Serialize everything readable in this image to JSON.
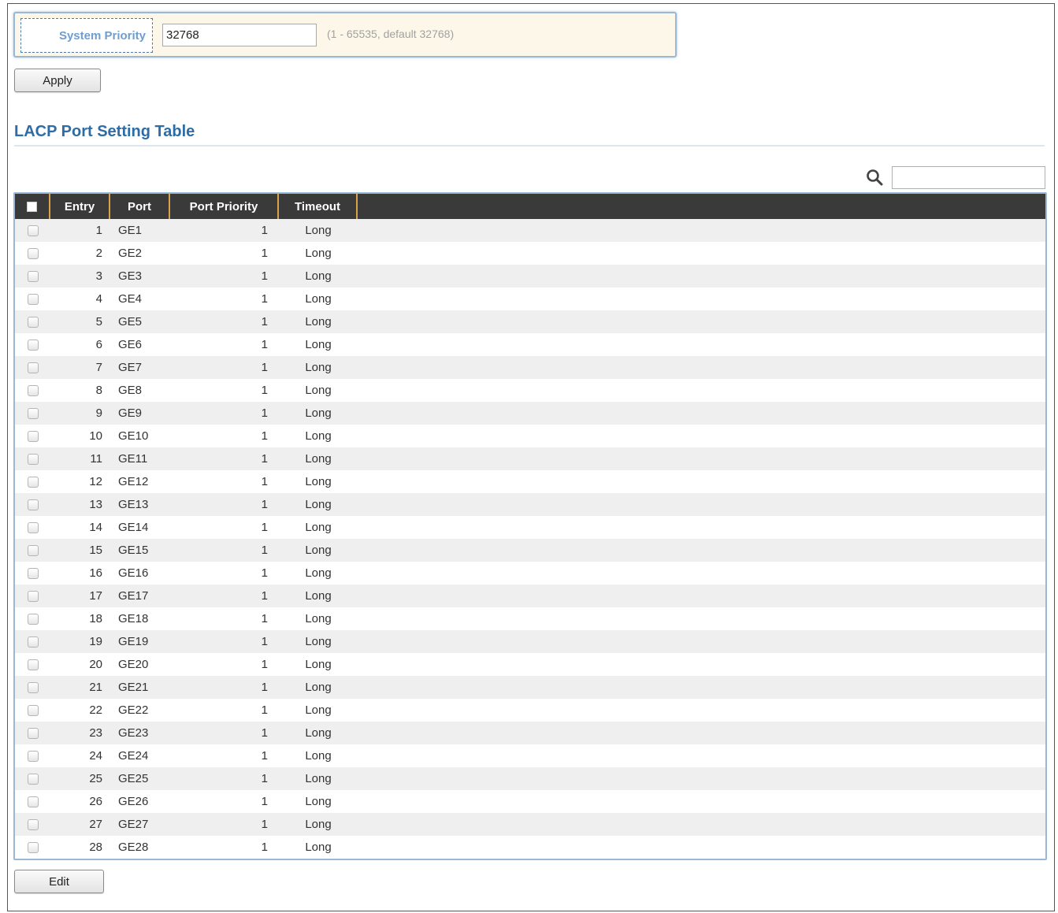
{
  "system": {
    "label": "System Priority",
    "value": "32768",
    "hint": "(1 - 65535, default 32768)",
    "apply_label": "Apply"
  },
  "section": {
    "title": "LACP Port Setting Table"
  },
  "search": {
    "icon": "search-icon",
    "value": ""
  },
  "table": {
    "headers": {
      "entry": "Entry",
      "port": "Port",
      "priority": "Port Priority",
      "timeout": "Timeout"
    },
    "rows": [
      {
        "entry": "1",
        "port": "GE1",
        "priority": "1",
        "timeout": "Long"
      },
      {
        "entry": "2",
        "port": "GE2",
        "priority": "1",
        "timeout": "Long"
      },
      {
        "entry": "3",
        "port": "GE3",
        "priority": "1",
        "timeout": "Long"
      },
      {
        "entry": "4",
        "port": "GE4",
        "priority": "1",
        "timeout": "Long"
      },
      {
        "entry": "5",
        "port": "GE5",
        "priority": "1",
        "timeout": "Long"
      },
      {
        "entry": "6",
        "port": "GE6",
        "priority": "1",
        "timeout": "Long"
      },
      {
        "entry": "7",
        "port": "GE7",
        "priority": "1",
        "timeout": "Long"
      },
      {
        "entry": "8",
        "port": "GE8",
        "priority": "1",
        "timeout": "Long"
      },
      {
        "entry": "9",
        "port": "GE9",
        "priority": "1",
        "timeout": "Long"
      },
      {
        "entry": "10",
        "port": "GE10",
        "priority": "1",
        "timeout": "Long"
      },
      {
        "entry": "11",
        "port": "GE11",
        "priority": "1",
        "timeout": "Long"
      },
      {
        "entry": "12",
        "port": "GE12",
        "priority": "1",
        "timeout": "Long"
      },
      {
        "entry": "13",
        "port": "GE13",
        "priority": "1",
        "timeout": "Long"
      },
      {
        "entry": "14",
        "port": "GE14",
        "priority": "1",
        "timeout": "Long"
      },
      {
        "entry": "15",
        "port": "GE15",
        "priority": "1",
        "timeout": "Long"
      },
      {
        "entry": "16",
        "port": "GE16",
        "priority": "1",
        "timeout": "Long"
      },
      {
        "entry": "17",
        "port": "GE17",
        "priority": "1",
        "timeout": "Long"
      },
      {
        "entry": "18",
        "port": "GE18",
        "priority": "1",
        "timeout": "Long"
      },
      {
        "entry": "19",
        "port": "GE19",
        "priority": "1",
        "timeout": "Long"
      },
      {
        "entry": "20",
        "port": "GE20",
        "priority": "1",
        "timeout": "Long"
      },
      {
        "entry": "21",
        "port": "GE21",
        "priority": "1",
        "timeout": "Long"
      },
      {
        "entry": "22",
        "port": "GE22",
        "priority": "1",
        "timeout": "Long"
      },
      {
        "entry": "23",
        "port": "GE23",
        "priority": "1",
        "timeout": "Long"
      },
      {
        "entry": "24",
        "port": "GE24",
        "priority": "1",
        "timeout": "Long"
      },
      {
        "entry": "25",
        "port": "GE25",
        "priority": "1",
        "timeout": "Long"
      },
      {
        "entry": "26",
        "port": "GE26",
        "priority": "1",
        "timeout": "Long"
      },
      {
        "entry": "27",
        "port": "GE27",
        "priority": "1",
        "timeout": "Long"
      },
      {
        "entry": "28",
        "port": "GE28",
        "priority": "1",
        "timeout": "Long"
      }
    ]
  },
  "edit_label": "Edit",
  "colors": {
    "accent_blue": "#2e6ca5",
    "panel_bg": "#fcf7e8",
    "header_bg": "#3a3a3a",
    "header_divider": "#d7a24a"
  }
}
